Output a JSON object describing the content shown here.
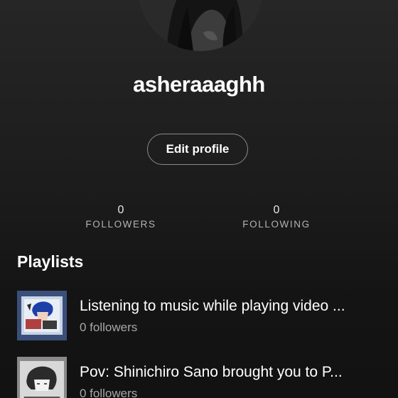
{
  "profile": {
    "username": "asheraaaghh",
    "edit_label": "Edit profile"
  },
  "stats": {
    "followers": {
      "value": "0",
      "label": "FOLLOWERS"
    },
    "following": {
      "value": "0",
      "label": "FOLLOWING"
    }
  },
  "playlists": {
    "title": "Playlists",
    "items": [
      {
        "title": "Listening to music while playing video ...",
        "subtitle": "0 followers"
      },
      {
        "title": "Pov: Shinichiro Sano brought you to P...",
        "subtitle": "0 followers"
      }
    ]
  },
  "colors": {
    "background": "#121212",
    "text_primary": "#ffffff",
    "text_secondary": "#a7a7a7"
  }
}
